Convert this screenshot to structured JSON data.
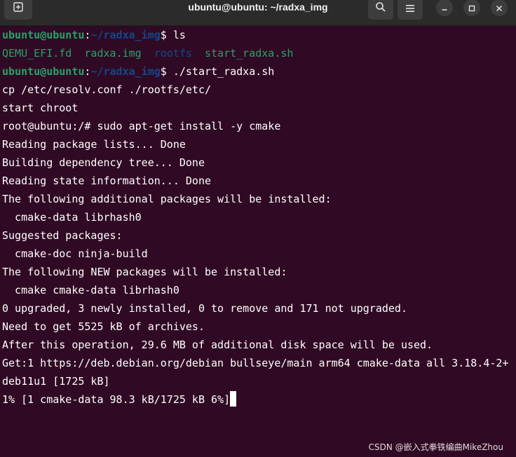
{
  "window": {
    "title": "ubuntu@ubuntu: ~/radxa_img",
    "icons": [
      "new-tab-icon",
      "search-icon",
      "hamburger-menu-icon",
      "minimize-icon",
      "maximize-icon",
      "close-icon"
    ]
  },
  "colors": {
    "background": "#300a24",
    "prompt_user": "#26a269",
    "prompt_path": "#12488b",
    "text": "#ffffff"
  },
  "terminal": {
    "line1": {
      "user": "ubuntu@ubuntu",
      "colon": ":",
      "path": "~/radxa_img",
      "symbol": "$ ",
      "cmd": "ls"
    },
    "ls_output": {
      "f1": "QEMU_EFI.fd",
      "sep1": "  ",
      "f2": "radxa.img",
      "sep2": "  ",
      "f3": "rootfs",
      "sep3": "  ",
      "f4": "start_radxa.sh"
    },
    "line3": {
      "user": "ubuntu@ubuntu",
      "colon": ":",
      "path": "~/radxa_img",
      "symbol": "$ ",
      "cmd": "./start_radxa.sh"
    },
    "output": [
      "cp /etc/resolv.conf ./rootfs/etc/",
      "start chroot",
      "root@ubuntu:/# sudo apt-get install -y cmake",
      "Reading package lists... Done",
      "Building dependency tree... Done",
      "Reading state information... Done",
      "The following additional packages will be installed:",
      "  cmake-data librhash0",
      "Suggested packages:",
      "  cmake-doc ninja-build",
      "The following NEW packages will be installed:",
      "  cmake cmake-data librhash0",
      "0 upgraded, 3 newly installed, 0 to remove and 171 not upgraded.",
      "Need to get 5525 kB of archives.",
      "After this operation, 29.6 MB of additional disk space will be used.",
      "Get:1 https://deb.debian.org/debian bullseye/main arm64 cmake-data all 3.18.4-2+",
      "deb11u1 [1725 kB]"
    ],
    "progress_line": "1% [1 cmake-data 98.3 kB/1725 kB 6%]"
  },
  "watermark": "CSDN @嵌入式拳铁编曲MikeZhou"
}
